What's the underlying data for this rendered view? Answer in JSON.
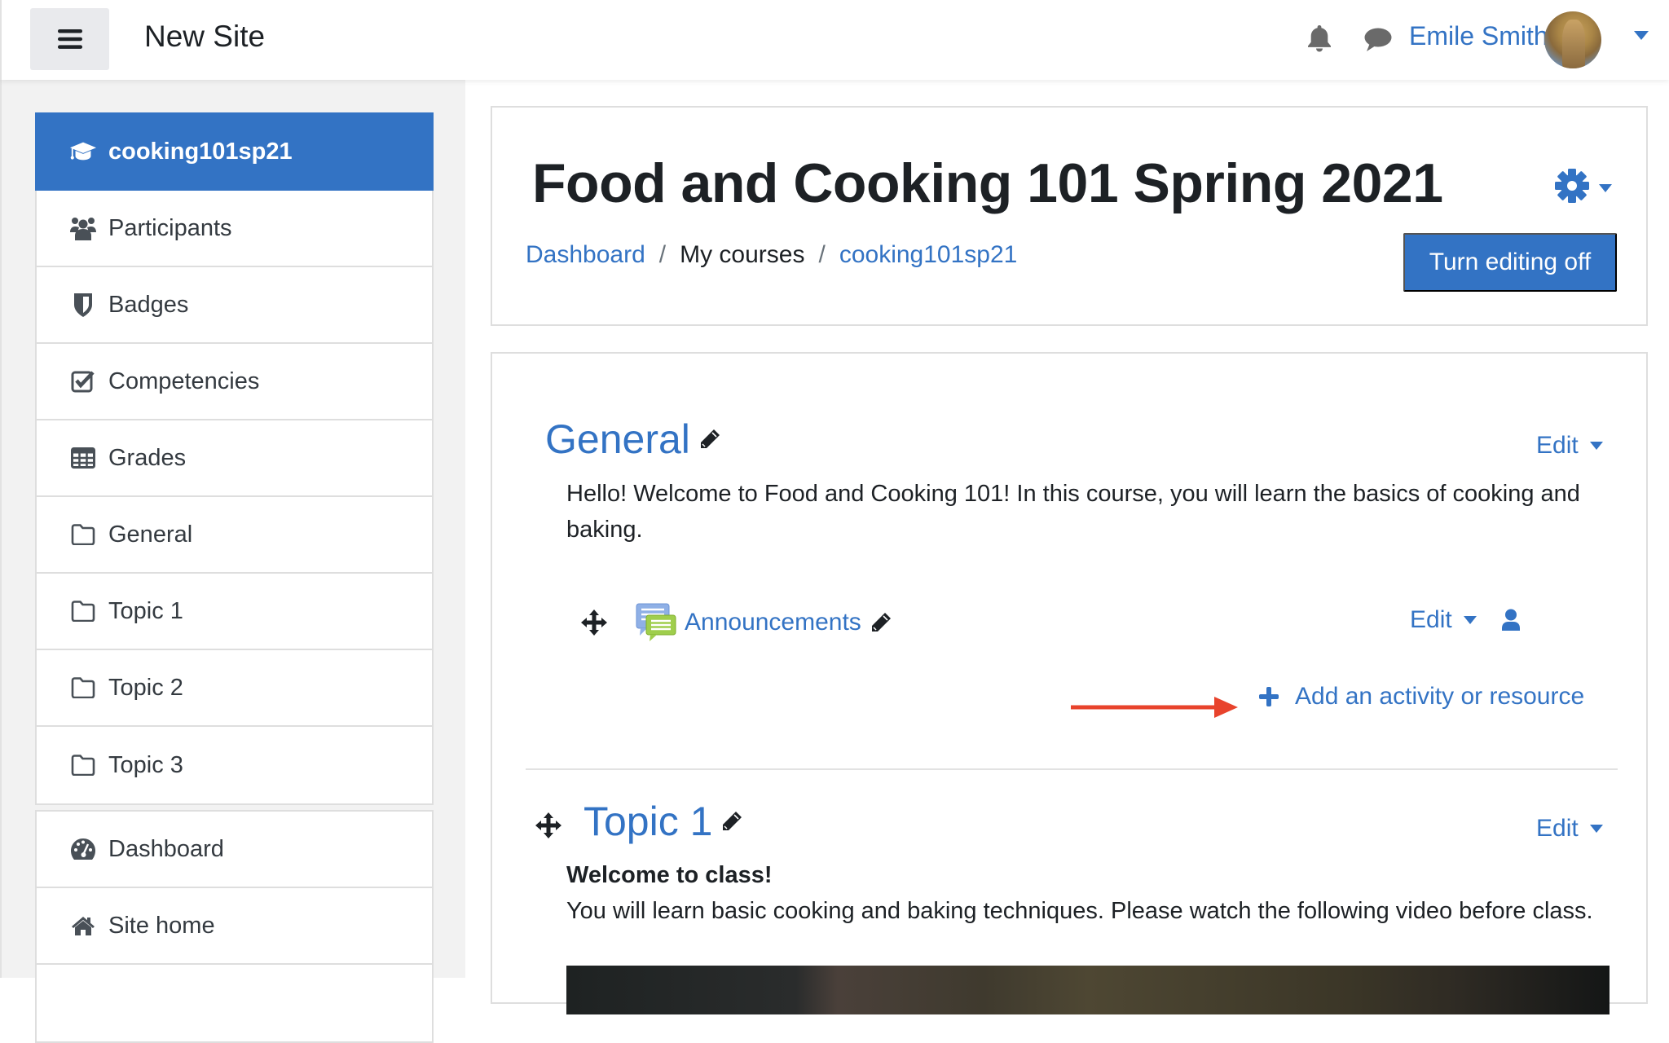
{
  "navbar": {
    "menu_icon": "hamburger-icon",
    "site_name": "New Site",
    "notifications_icon": "bell-icon",
    "messages_icon": "chat-bubble-icon",
    "user_name": "Emile Smith",
    "user_menu_icon": "caret-down-icon"
  },
  "sidebar": {
    "primary": [
      {
        "label": "cooking101sp21",
        "icon": "graduation-cap-icon",
        "active": true
      },
      {
        "label": "Participants",
        "icon": "users-icon"
      },
      {
        "label": "Badges",
        "icon": "shield-icon"
      },
      {
        "label": "Competencies",
        "icon": "checkbox-icon"
      },
      {
        "label": "Grades",
        "icon": "table-icon"
      },
      {
        "label": "General",
        "icon": "folder-icon"
      },
      {
        "label": "Topic 1",
        "icon": "folder-icon"
      },
      {
        "label": "Topic 2",
        "icon": "folder-icon"
      },
      {
        "label": "Topic 3",
        "icon": "folder-icon"
      }
    ],
    "secondary": [
      {
        "label": "Dashboard",
        "icon": "tachometer-icon"
      },
      {
        "label": "Site home",
        "icon": "home-icon"
      }
    ]
  },
  "header": {
    "course_title": "Food and Cooking 101 Spring 2021",
    "breadcrumb": [
      {
        "label": "Dashboard",
        "link": true
      },
      {
        "label": "My courses",
        "link": false
      },
      {
        "label": "cooking101sp21",
        "link": true
      }
    ],
    "breadcrumb_separator": "/",
    "edit_toggle_label": "Turn editing off",
    "settings_icon": "gear-icon"
  },
  "sections": [
    {
      "title": "General",
      "edit_label": "Edit",
      "summary": "Hello! Welcome to Food and Cooking 101! In this course, you will learn the basics of cooking and baking.",
      "activities": [
        {
          "name": "Announcements",
          "type": "forum",
          "edit_label": "Edit"
        }
      ],
      "add_activity_label": "Add an activity or resource"
    },
    {
      "title": "Topic 1",
      "edit_label": "Edit",
      "summary_heading": "Welcome to class!",
      "summary": "You will learn basic cooking and baking techniques. Please watch the following video before class."
    }
  ],
  "colors": {
    "brand": "#3373c4",
    "annotation_arrow": "#e8432c",
    "drawer_bg": "#f2f2f2"
  }
}
